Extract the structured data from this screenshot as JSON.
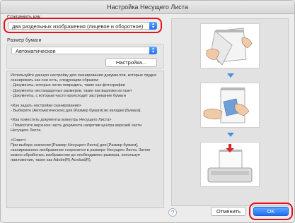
{
  "window": {
    "title": "Настройка Несущего Листа"
  },
  "save_as": {
    "label": "Сохранить как",
    "value": "два раздельных изображения (лицевое и оборотное)"
  },
  "paper_size": {
    "label": "Размер бумаги",
    "value": "Автоматическое",
    "settings_button": "Настройка..."
  },
  "info": {
    "p1": "Используйте данную настройку для сканирования документов, которые трудно сканировать как они есть, следующим образом:\n- Документы, которые легко повредить, такие как фотографии\n- Документы нестандартных размеров, такие как вырезки из газет\n- Документы, с которым часто происходит застревание бумаги",
    "p2": "<Как задать настройки сканирования>\n- Выберите [Автоматическое] для [Размер бумаги] во вкладке [Бумага].",
    "p3": "<Как поместить документы вовнутрь Несущего Листа>\n- Поместите верхнюю часть документа напротив центра верхней части Несущего Листа.",
    "p4": "<Совет>\nПри выборе значения [Размер Несущего Листа] для [Размер бумаги], сканированное изображение сохранится в размере Несущего Листа. Затем можно обработать изображение до необходимого размера, используя приложение, такое как Adobe(R) Acrobat(R)."
  },
  "buttons": {
    "help": "?",
    "cancel": "Отменить",
    "ok": "OK"
  },
  "colors": {
    "accent": "#1f6ff0",
    "highlight_ring": "#e3101a",
    "arrow": "#4a8fe0"
  },
  "icons": {
    "stepper": "up-down-chevron-icon",
    "illustration_1": "carrier-sheet-open-illustration",
    "illustration_2": "document-insert-illustration",
    "illustration_3": "scanner-feed-illustration"
  }
}
